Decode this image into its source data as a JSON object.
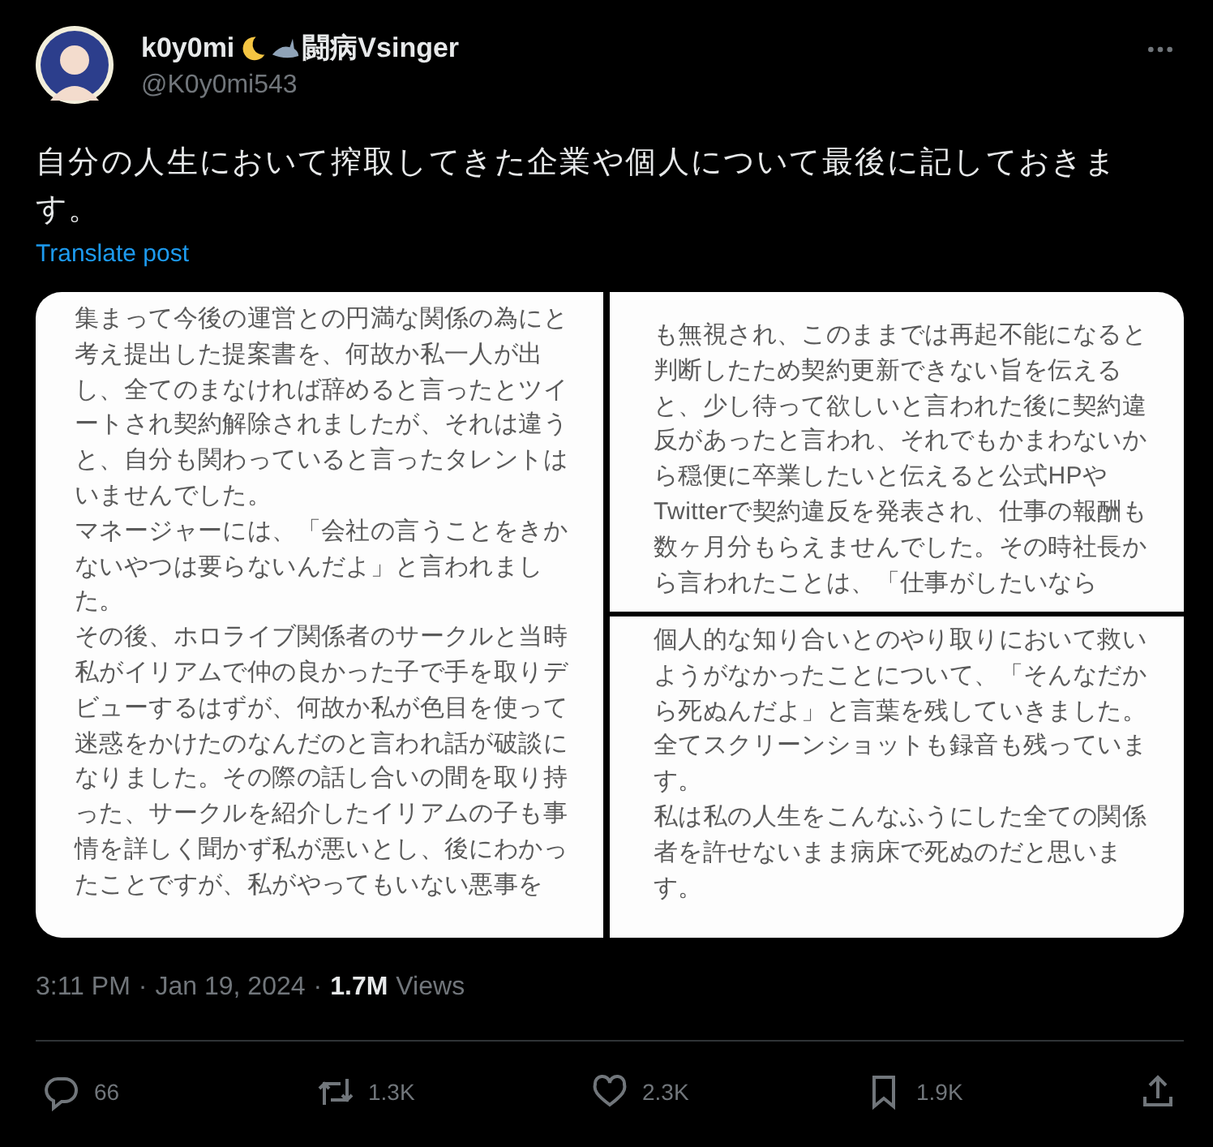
{
  "author": {
    "name_start": "k0y0mi",
    "name_end": "闘病Vsinger",
    "handle": "@K0y0mi543"
  },
  "post": {
    "text": "自分の人生において搾取してきた企業や個人について最後に記しておきます。",
    "translate_link": "Translate post"
  },
  "images": [
    {
      "lines": [
        "集まって今後の運営との円満な関係の為にと",
        "考え提出した提案書を、何故か私一人が出",
        "し、全てのまなければ辞めると言ったとツイ",
        "ートされ契約解除されましたが、それは違う",
        "と、自分も関わっていると言ったタレントは",
        "いませんでした。",
        "マネージャーには、「会社の言うことをきか",
        "ないやつは要らないんだよ」と言われまし",
        "た。",
        "その後、ホロライブ関係者のサークルと当時",
        "私がイリアムで仲の良かった子で手を取りデ",
        "ビューするはずが、何故か私が色目を使って",
        "迷惑をかけたのなんだのと言われ話が破談に",
        "なりました。その際の話し合いの間を取り持",
        "った、サークルを紹介したイリアムの子も事",
        "情を詳しく聞かず私が悪いとし、後にわかっ",
        "たことですが、私がやってもいない悪事を"
      ]
    },
    {
      "lines": [
        "も無視され、このままでは再起不能になると",
        "判断したため契約更新できない旨を伝える",
        "と、少し待って欲しいと言われた後に契約違",
        "反があったと言われ、それでもかまわないか",
        "ら穏便に卒業したいと伝えると公式HPや",
        "Twitterで契約違反を発表され、仕事の報酬も",
        "数ヶ月分もらえませんでした。その時社長か",
        "ら言われたことは、「仕事がしたいなら"
      ]
    },
    {
      "lines": [
        "個人的な知り合いとのやり取りにおいて救い",
        "ようがなかったことについて、「そんなだか",
        "ら死ぬんだよ」と言葉を残していきました。",
        "全てスクリーンショットも録音も残っていま",
        "す。",
        "私は私の人生をこんなふうにした全ての関係",
        "者を許せないまま病床で死ぬのだと思いま",
        "す。"
      ]
    }
  ],
  "meta": {
    "separator": "·",
    "time": "3:11 PM",
    "date": "Jan 19, 2024",
    "views_count": "1.7M",
    "views_label": "Views"
  },
  "actions": [
    {
      "kind": "reply",
      "count": "66"
    },
    {
      "kind": "repost",
      "count": "1.3K"
    },
    {
      "kind": "like",
      "count": "2.3K"
    },
    {
      "kind": "bookmark",
      "count": "1.9K"
    },
    {
      "kind": "share"
    }
  ]
}
